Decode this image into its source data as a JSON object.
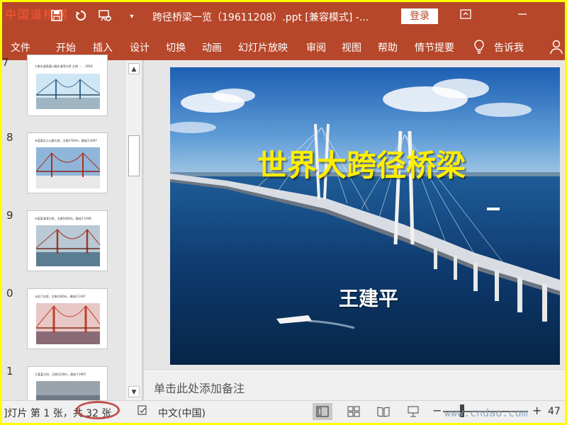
{
  "titlebar": {
    "watermark": "中国道桥网",
    "doc_title": "跨径桥梁一览（19611208）.ppt [兼容模式]  -...",
    "login_label": "登录",
    "icons": [
      "save-icon",
      "undo-icon",
      "presenter-icon",
      "customize-qat-icon",
      "ribbon-display-icon",
      "minimize-icon"
    ]
  },
  "ribbon": {
    "tabs": [
      "文件",
      "开始",
      "插入",
      "设计",
      "切换",
      "动画",
      "幻灯片放映",
      "审阅",
      "视图",
      "帮助",
      "情节提要"
    ],
    "tell_me": "告诉我"
  },
  "thumbnails": [
    {
      "number": "7",
      "caption": "⑦甬台温高速公路乐清湾大桥  主跨 …… 2016"
    },
    {
      "number": "8",
      "caption": "⑧某某长江公路大桥，主跨1700m，建成于2007"
    },
    {
      "number": "9",
      "caption": "⑨某某海湾大桥，主跨1000m，建成于1936"
    },
    {
      "number": "0",
      "caption": "⑩金门大桥，主跨1280m，建成于1937"
    },
    {
      "number": "1",
      "caption": "⑪某某大桥，主跨1100m，建成于1997"
    }
  ],
  "slide": {
    "title": "世界大跨径桥梁",
    "author": "王建平"
  },
  "notes": {
    "placeholder": "单击此处添加备注"
  },
  "statusbar": {
    "slide_info": "]灯片 第 1 张，共 32 张",
    "language": "中文(中国)",
    "zoom_minus": "−",
    "zoom_plus": "+",
    "zoom_value": "47",
    "watermark": "www.cndao.com"
  },
  "colors": {
    "accent": "#b7472a",
    "highlight_ring": "#c0504d",
    "title_text": "#ffee00",
    "page_border": "#ffff00"
  }
}
